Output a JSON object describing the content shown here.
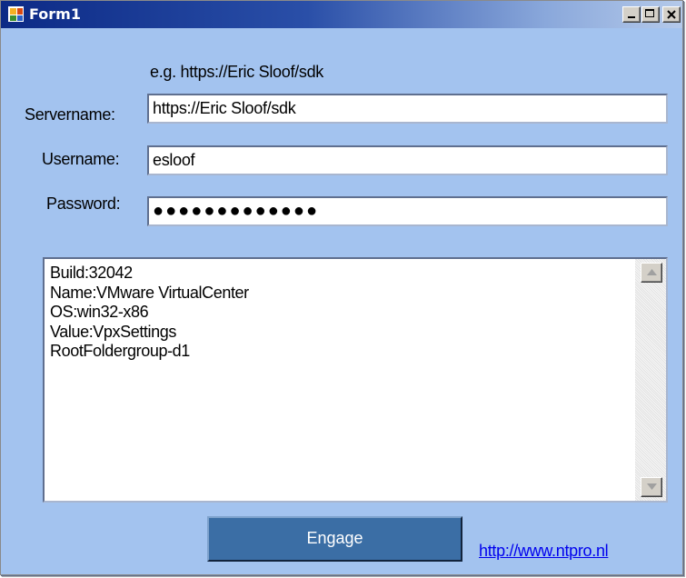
{
  "window": {
    "title": "Form1",
    "icons": {
      "app": "app-form-icon",
      "minimize": "minimize-icon",
      "maximize": "maximize-icon",
      "close": "close-icon"
    }
  },
  "form": {
    "hint": "e.g. https://Eric Sloof/sdk",
    "servername_label": "Servername:",
    "servername_value": "https://Eric Sloof/sdk",
    "username_label": "Username:",
    "username_value": "esloof",
    "password_label": "Password:",
    "password_display": "●●●●●●●●●●●●●"
  },
  "output": {
    "lines": [
      "Build:32042",
      "Name:VMware VirtualCenter",
      "OS:win32-x86",
      "Value:VpxSettings",
      "RootFoldergroup-d1"
    ]
  },
  "actions": {
    "engage_label": "Engage",
    "link_text": "http://www.ntpro.nl"
  },
  "colors": {
    "form_background": "#a3c3ef",
    "button_background": "#3b6ea5",
    "link": "#0000ee"
  }
}
